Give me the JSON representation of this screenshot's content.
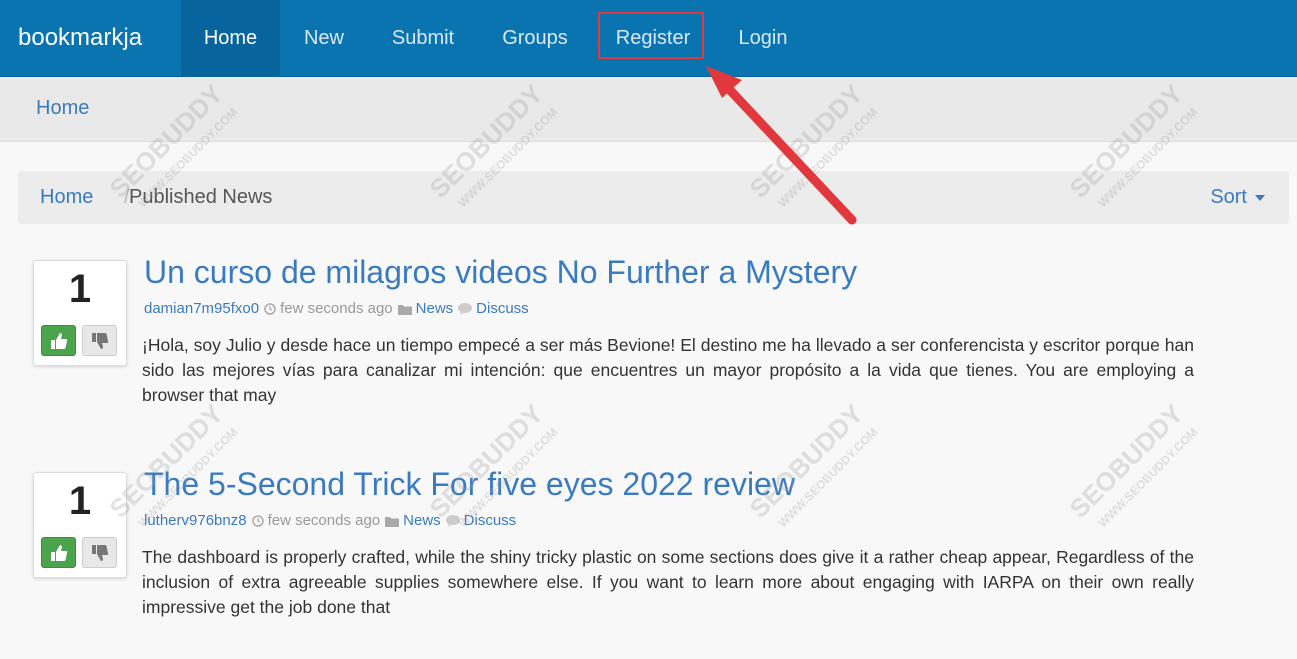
{
  "navbar": {
    "brand": "bookmarkja",
    "items": [
      {
        "label": "Home",
        "active": true
      },
      {
        "label": "New"
      },
      {
        "label": "Submit"
      },
      {
        "label": "Groups"
      },
      {
        "label": "Register",
        "highlighted": true
      },
      {
        "label": "Login"
      }
    ]
  },
  "subheader": {
    "home": "Home"
  },
  "breadcrumb": {
    "home": "Home",
    "separator": "/",
    "current": "Published News",
    "sort": "Sort"
  },
  "stories": [
    {
      "votes": "1",
      "title": "Un curso de milagros videos No Further a Mystery",
      "author": "damian7m95fxo0",
      "time": "few seconds ago",
      "category": "News",
      "discuss": "Discuss",
      "body": "¡Hola, soy Julio y desde hace un tiempo empecé a ser más Bevione! El destino me ha llevado a ser conferencista y escritor porque han sido las mejores vías para canalizar mi intención: que encuentres un mayor propósito a la vida que tienes. You are employing a browser that may"
    },
    {
      "votes": "1",
      "title": "The 5-Second Trick For five eyes 2022 review",
      "author": "lutherv976bnz8",
      "time": "few seconds ago",
      "category": "News",
      "discuss": "Discuss",
      "body": "The dashboard is properly crafted, while the shiny tricky plastic on some sections does give it a rather cheap appear, Regardless of the inclusion of extra agreeable supplies somewhere else. If you want to learn more about engaging with IARPA on their own really impressive get the job done that"
    }
  ],
  "watermark": {
    "brand": "SEOBUDDY",
    "url": "WWW.SEOBUDDY.COM"
  },
  "colors": {
    "navbar": "#0a74b1",
    "link": "#3a7bbf",
    "annotation": "#e0383c",
    "vote_up": "#4ba34b"
  }
}
